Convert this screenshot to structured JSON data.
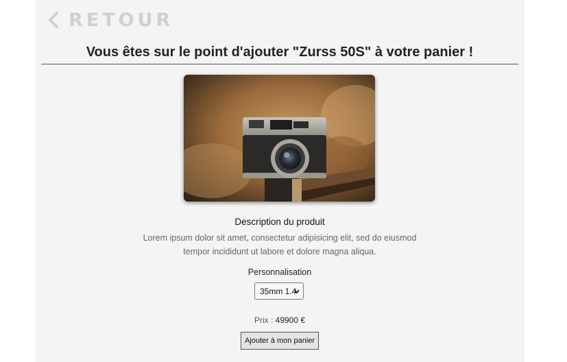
{
  "header": {
    "back_label": "RETOUR",
    "back_icon": "chevron-left-icon",
    "title": "Vous êtes sur le point d'ajouter \"Zurss 50S\" à votre panier !"
  },
  "product": {
    "image_icon": "camera-photo",
    "description_title": "Description du produit",
    "description_text": "Lorem ipsum dolor sit amet, consectetur adipisicing elit, sed do eiusmod tempor incididunt ut labore et dolore magna aliqua."
  },
  "customization": {
    "label": "Personnalisation",
    "selected": "35mm 1.4"
  },
  "price": {
    "label": "Prix : ",
    "value": "49900 €"
  },
  "actions": {
    "add_to_cart": "Ajouter à mon panier"
  },
  "colors": {
    "panel_bg": "#f4f4f4",
    "back_color": "#d0d0d0",
    "text_dark": "#222222"
  }
}
